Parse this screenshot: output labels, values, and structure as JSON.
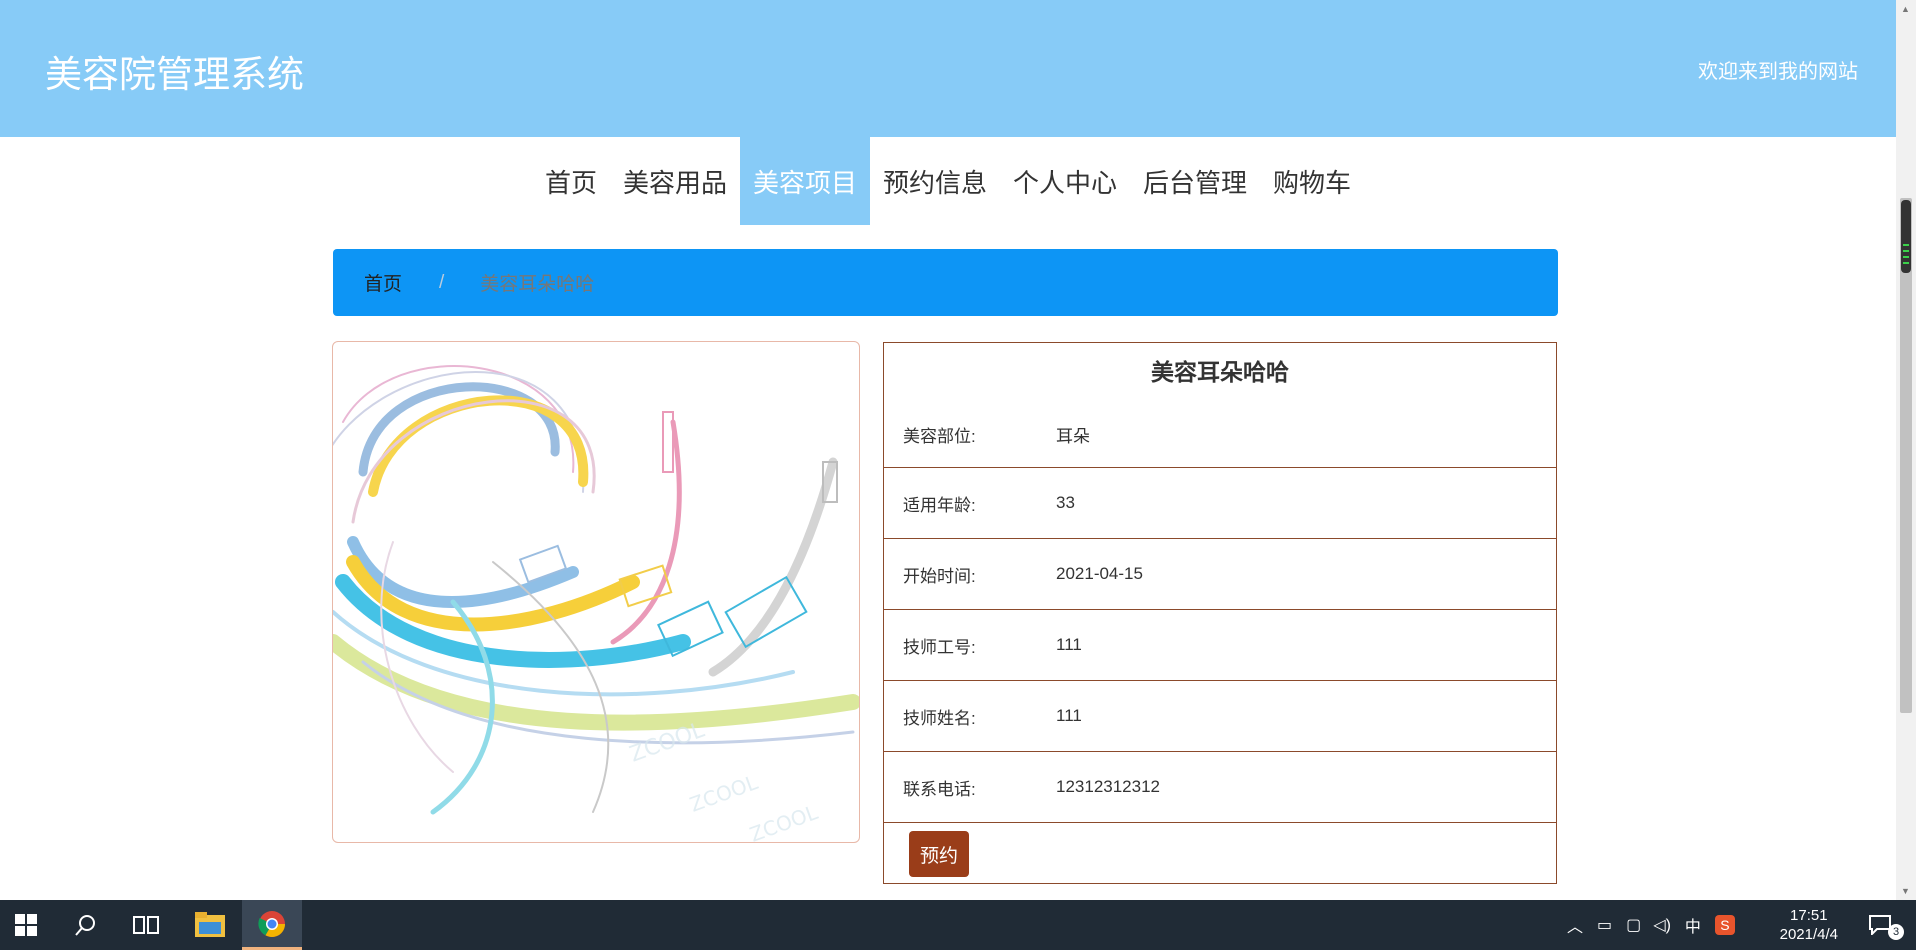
{
  "header": {
    "site_title": "美容院管理系统",
    "welcome": "欢迎来到我的网站"
  },
  "nav": {
    "items": [
      {
        "label": "首页",
        "active": false
      },
      {
        "label": "美容用品",
        "active": false
      },
      {
        "label": "美容项目",
        "active": true
      },
      {
        "label": "预约信息",
        "active": false
      },
      {
        "label": "个人中心",
        "active": false
      },
      {
        "label": "后台管理",
        "active": false
      },
      {
        "label": "购物车",
        "active": false
      }
    ]
  },
  "breadcrumb": {
    "home": "首页",
    "separator": "/",
    "current": "美容耳朵哈哈"
  },
  "detail": {
    "title": "美容耳朵哈哈",
    "rows": [
      {
        "label": "美容部位:",
        "value": "耳朵"
      },
      {
        "label": "适用年龄:",
        "value": "33"
      },
      {
        "label": "开始时间:",
        "value": "2021-04-15"
      },
      {
        "label": "技师工号:",
        "value": "111"
      },
      {
        "label": "技师姓名:",
        "value": "111"
      },
      {
        "label": "联系电话:",
        "value": "12312312312"
      }
    ],
    "book_button": "预约"
  },
  "taskbar": {
    "ime": "中",
    "time": "17:51",
    "date": "2021/4/4",
    "notification_count": "3"
  },
  "colors": {
    "header_bg": "#87cbf7",
    "breadcrumb_bg": "#0d95f5",
    "accent_brown": "#9a3d19",
    "taskbar_bg": "#202b36"
  }
}
